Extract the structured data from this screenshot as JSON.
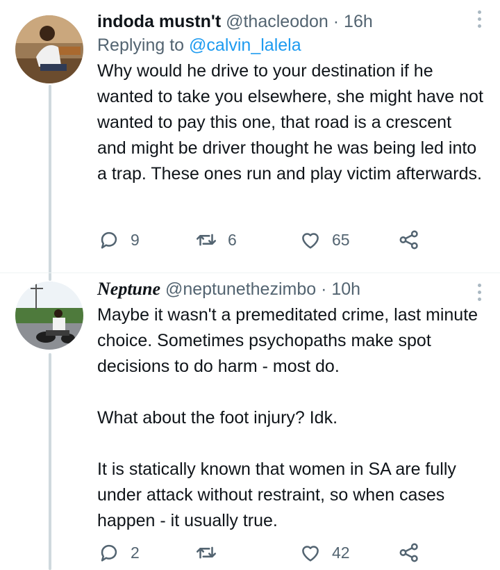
{
  "tweets": [
    {
      "name": "indoda mustn't",
      "handle": "@thacleodon",
      "time": "· 16h",
      "replying_prefix": "Replying to",
      "replying_to": "@calvin_lalela",
      "paragraphs": [
        "Why would he drive to your destination if he wanted to take you elsewhere, she might have not wanted to pay this one, that road is a crescent and might be driver thought he was being led into a trap. These ones run and play victim afterwards."
      ],
      "replies": "9",
      "retweets": "6",
      "likes": "65",
      "icons": [
        "reply-icon",
        "retweet-icon",
        "like-icon",
        "share-icon",
        "more-icon"
      ]
    },
    {
      "name": "Neptune",
      "handle": "@neptunethezimbo",
      "time": "· 10h",
      "paragraphs": [
        "Maybe it wasn't a premeditated crime, last minute choice. Sometimes psychopaths make spot decisions to do harm - most do.",
        "What about the foot injury? Idk.",
        "It is statically known that women in SA are fully under attack without restraint, so when cases happen - it usually true."
      ],
      "replies": "2",
      "retweets": "",
      "likes": "42",
      "icons": [
        "reply-icon",
        "retweet-icon",
        "like-icon",
        "share-icon",
        "more-icon"
      ]
    }
  ],
  "colors": {
    "text": "#0f1419",
    "muted": "#536471",
    "link": "#1d9bf0",
    "thread": "#cfd9de"
  }
}
